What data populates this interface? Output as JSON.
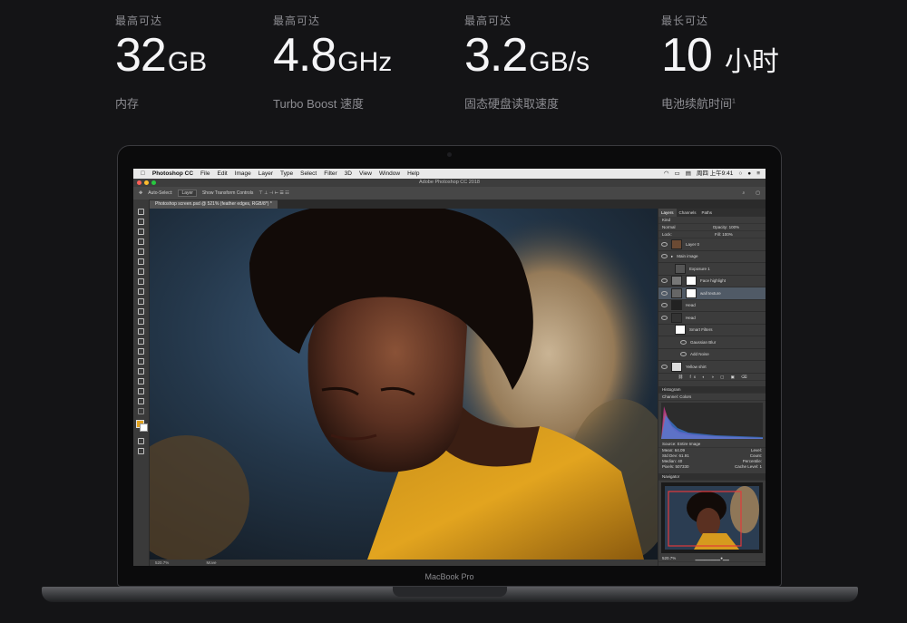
{
  "specs": [
    {
      "caption": "最高可达",
      "number": "32",
      "unit": "GB",
      "sub": "内存",
      "sup": ""
    },
    {
      "caption": "最高可达",
      "number": "4.8",
      "unit": "GHz",
      "sub": "Turbo Boost 速度",
      "sup": ""
    },
    {
      "caption": "最高可达",
      "number": "3.2",
      "unit": "GB/s",
      "sub": "固态硬盘读取速度",
      "sup": ""
    },
    {
      "caption": "最长可达",
      "number": "10",
      "unit": "小时",
      "sub": "电池续航时间",
      "sup": "1"
    }
  ],
  "device_label": "MacBook Pro",
  "menubar": {
    "app_name": "Photoshop CC",
    "items": [
      "File",
      "Edit",
      "Image",
      "Layer",
      "Type",
      "Select",
      "Filter",
      "3D",
      "View",
      "Window",
      "Help"
    ],
    "clock": "周四 上午9:41"
  },
  "window": {
    "title": "Adobe Photoshop CC 2018"
  },
  "options_bar": {
    "auto_select": "Auto-Select:",
    "layer_value": "Layer",
    "show_transform": "Show Transform Controls"
  },
  "document_tab": "Photoshop screen.psd @ 521% (feather edges, RGB/8*) *",
  "status_bar": {
    "zoom": "520.7%",
    "mode": "Move"
  },
  "layers_panel": {
    "tabs": [
      "Layers",
      "Channels",
      "Paths"
    ],
    "kind_label": "Kind",
    "blend_mode": "Normal",
    "opacity_label": "Opacity:",
    "opacity_value": "100%",
    "lock_label": "Lock:",
    "fill_label": "Fill:",
    "fill_value": "100%",
    "layers": [
      {
        "name": "Layer 0"
      },
      {
        "name": "Main image"
      },
      {
        "name": "Exposure 1"
      },
      {
        "name": "Face highlight"
      },
      {
        "name": "wall texture"
      },
      {
        "name": "Head"
      },
      {
        "name": "Head"
      },
      {
        "name": "Smart Filters"
      },
      {
        "name": "Gaussian Blur"
      },
      {
        "name": "Add Noise"
      },
      {
        "name": "Yellow shirt"
      }
    ]
  },
  "histogram_panel": {
    "title": "Histogram",
    "channel_label": "Channel:",
    "channel_value": "Colors",
    "source_label": "Source:",
    "source_value": "Entire Image",
    "stats_left": [
      {
        "label": "Mean:",
        "value": "64.09"
      },
      {
        "label": "Std Dev:",
        "value": "61.91"
      },
      {
        "label": "Median:",
        "value": "40"
      },
      {
        "label": "Pixels:",
        "value": "507330"
      }
    ],
    "stats_right": [
      "Level:",
      "Count:",
      "Percentile:",
      "Cache Level: 1"
    ]
  },
  "navigator_panel": {
    "title": "Navigator",
    "zoom": "520.7%"
  }
}
